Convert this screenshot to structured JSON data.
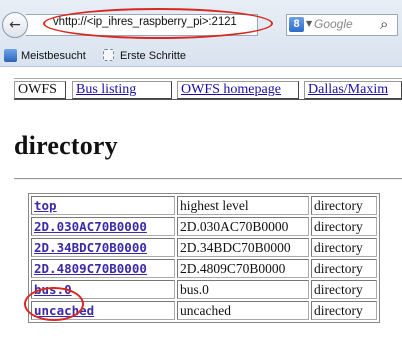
{
  "browser": {
    "url": "vhttp://<ip_ihres_raspberry_pi>:2121",
    "search_engine_letter": "8",
    "search_placeholder": "Google",
    "bookmarks": [
      {
        "label": "Meistbesucht"
      },
      {
        "label": "Erste Schritte"
      }
    ],
    "accent_color": "#d8281f"
  },
  "page": {
    "nav": [
      {
        "label": "OWFS",
        "link": false
      },
      {
        "label": "Bus listing",
        "link": true
      },
      {
        "label": "OWFS homepage",
        "link": true
      },
      {
        "label": "Dallas/Maxim",
        "link": true
      }
    ],
    "title": "directory",
    "rows": [
      {
        "name": "top",
        "description": "highest level",
        "type": "directory"
      },
      {
        "name": "2D.030AC70B0000",
        "description": "2D.030AC70B0000",
        "type": "directory"
      },
      {
        "name": "2D.34BDC70B0000",
        "description": "2D.34BDC70B0000",
        "type": "directory"
      },
      {
        "name": "2D.4809C70B0000",
        "description": "2D.4809C70B0000",
        "type": "directory"
      },
      {
        "name": "bus.0",
        "description": "bus.0",
        "type": "directory"
      },
      {
        "name": "uncached",
        "description": "uncached",
        "type": "directory"
      }
    ]
  }
}
